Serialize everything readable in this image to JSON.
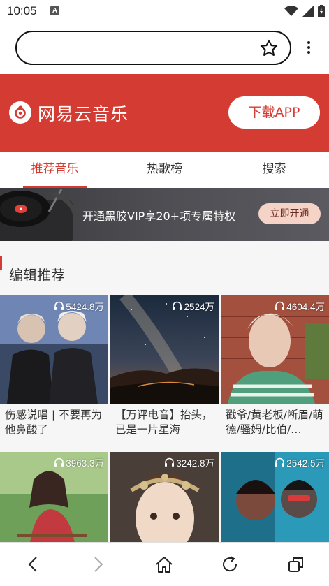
{
  "status_bar": {
    "time": "10:05",
    "notification_letter": "A"
  },
  "header": {
    "brand_name": "网易云音乐",
    "download_button": "下载APP"
  },
  "tabs": [
    {
      "label": "推荐音乐",
      "active": true
    },
    {
      "label": "热歌榜",
      "active": false
    },
    {
      "label": "搜索",
      "active": false
    }
  ],
  "banner": {
    "text": "开通黑胶VIP享20+项专属特权",
    "button": "立即开通"
  },
  "section": {
    "title": "编辑推荐"
  },
  "playlists": [
    {
      "plays": "5424.8万",
      "title": "伤感说唱 | 不要再为他鼻酸了"
    },
    {
      "plays": "2524万",
      "title": "【万评电音】抬头，已是一片星海"
    },
    {
      "plays": "4604.4万",
      "title": "戳爷/黄老板/断眉/萌德/骚姆/比伯/…"
    },
    {
      "plays": "3963.3万",
      "title": ""
    },
    {
      "plays": "3242.8万",
      "title": ""
    },
    {
      "plays": "2542.5万",
      "title": ""
    }
  ],
  "colors": {
    "brand_red": "#d43c33",
    "vip_button": "#f5d3c7"
  },
  "icons": [
    "wifi-icon",
    "signal-icon",
    "battery-icon",
    "star-icon",
    "kebab-menu-icon",
    "netease-logo-icon",
    "vinyl-record-icon",
    "headphone-icon",
    "back-icon",
    "forward-icon",
    "home-icon",
    "reload-icon",
    "tabs-icon"
  ]
}
